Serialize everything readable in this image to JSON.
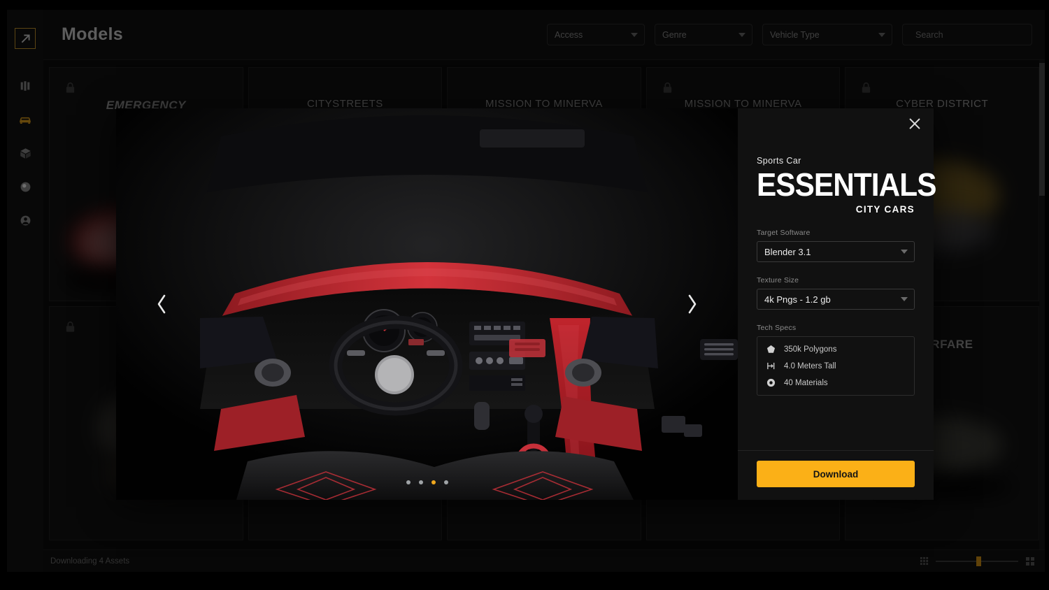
{
  "window": {
    "title": "Models"
  },
  "sidebar": {
    "logo": {
      "icon": "arrow-up-right-icon"
    },
    "items": [
      {
        "name": "library",
        "icon": "columns-icon",
        "active": false
      },
      {
        "name": "vehicles",
        "icon": "car-icon",
        "active": true
      },
      {
        "name": "props",
        "icon": "box-icon",
        "active": false
      },
      {
        "name": "materials",
        "icon": "sphere-icon",
        "active": false
      },
      {
        "name": "account",
        "icon": "user-icon",
        "active": false
      }
    ],
    "active_color": "#e3a11b"
  },
  "header": {
    "title": "Models",
    "filters": [
      {
        "label": "Access"
      },
      {
        "label": "Genre"
      },
      {
        "label": "Vehicle Type"
      }
    ],
    "search": {
      "placeholder": "Search",
      "value": "",
      "icon": "search-icon"
    }
  },
  "grid": {
    "rows": [
      [
        {
          "title": "EMERGENCY",
          "locked": true,
          "style": "italic"
        },
        {
          "title": "CITYSTREETS",
          "locked": false,
          "style": "thin"
        },
        {
          "title": "MISSION TO MINERVA",
          "locked": false,
          "style": "thin"
        },
        {
          "title": "MISSION TO MINERVA",
          "locked": true,
          "style": "thin"
        },
        {
          "title": "CYBER DISTRICT",
          "locked": true,
          "style": "cyber"
        }
      ],
      [
        {
          "title": "",
          "locked": true,
          "style": "thin"
        },
        {
          "title": "",
          "locked": false,
          "style": "thin"
        },
        {
          "title": "",
          "locked": false,
          "style": "thin"
        },
        {
          "title": "",
          "locked": false,
          "style": "thin"
        },
        {
          "title": "WARFARE",
          "locked": false,
          "style": "bold"
        }
      ]
    ]
  },
  "status": {
    "text": "Downloading 4 Assets",
    "zoom": {
      "small_icon": "grid-small-icon",
      "large_icon": "grid-large-icon",
      "value": 49
    }
  },
  "modal": {
    "close_label": "✕",
    "preview": {
      "prev_label": "‹",
      "next_label": "›",
      "dots": 4,
      "active_dot": 3,
      "alt": "Sports car interior — red and black cockpit with steering wheel"
    },
    "detail": {
      "kicker": "Sports Car",
      "title": "ESSENTIALS",
      "subtitle": "CITY CARS",
      "target_software": {
        "label": "Target Software",
        "value": "Blender 3.1"
      },
      "texture_size": {
        "label": "Texture Size",
        "value": "4k Pngs - 1.2 gb"
      },
      "tech_specs": {
        "label": "Tech Specs",
        "items": [
          {
            "icon": "polygon-icon",
            "text": "350k Polygons"
          },
          {
            "icon": "height-icon",
            "text": "4.0 Meters Tall"
          },
          {
            "icon": "material-icon",
            "text": "40 Materials"
          }
        ]
      },
      "download_label": "Download",
      "accent_color": "#fbb017"
    }
  }
}
